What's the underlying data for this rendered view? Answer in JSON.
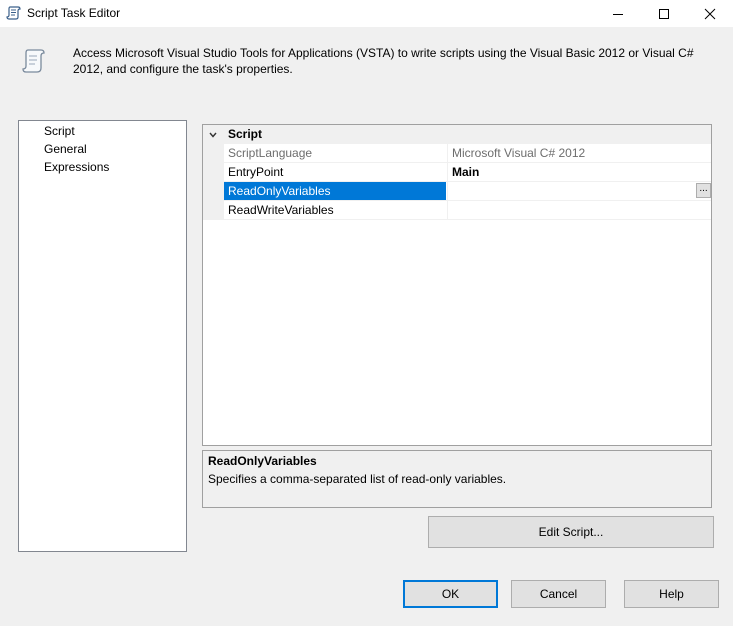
{
  "window": {
    "title": "Script Task Editor",
    "icon": "script-scroll-icon",
    "controls": {
      "minimize": "minimize-icon",
      "maximize": "maximize-icon",
      "close": "close-icon"
    }
  },
  "header": {
    "icon": "script-scroll-icon",
    "description": "Access Microsoft Visual Studio Tools for Applications (VSTA) to write scripts using the Visual Basic 2012 or Visual C# 2012, and configure the task's properties."
  },
  "nav": {
    "items": [
      {
        "label": "Script",
        "selected": true
      },
      {
        "label": "General",
        "selected": false
      },
      {
        "label": "Expressions",
        "selected": false
      }
    ]
  },
  "grid": {
    "category": "Script",
    "rows": [
      {
        "name": "ScriptLanguage",
        "value": "Microsoft Visual C# 2012",
        "readonly": true
      },
      {
        "name": "EntryPoint",
        "value": "Main",
        "bold": true
      },
      {
        "name": "ReadOnlyVariables",
        "value": "",
        "selected": true,
        "has_ellipsis": true,
        "ellipsis_label": "..."
      },
      {
        "name": "ReadWriteVariables",
        "value": ""
      }
    ]
  },
  "description": {
    "title": "ReadOnlyVariables",
    "text": "Specifies a comma-separated list of read-only variables."
  },
  "buttons": {
    "edit_script": "Edit Script...",
    "ok": "OK",
    "cancel": "Cancel",
    "help": "Help"
  },
  "colors": {
    "accent": "#0078d7",
    "dialog_background": "#f0f0f0",
    "readonly_text": "#6d6d6d"
  }
}
